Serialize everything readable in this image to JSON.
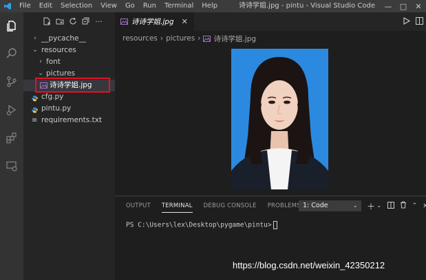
{
  "window": {
    "title": "诗诗学姐.jpg - pintu - Visual Studio Code",
    "menu": [
      "File",
      "Edit",
      "Selection",
      "View",
      "Go",
      "Run",
      "Terminal",
      "Help"
    ],
    "controls": [
      "—",
      "□",
      "✕"
    ]
  },
  "activity_bar": [
    "files-icon",
    "search-icon",
    "source-control-icon",
    "run-debug-icon",
    "extensions-icon",
    "remote-explorer-icon"
  ],
  "explorer": {
    "tree": [
      {
        "label": "__pycache__",
        "type": "folder",
        "expanded": false
      },
      {
        "label": "resources",
        "type": "folder",
        "expanded": true
      },
      {
        "label": "font",
        "type": "folder",
        "expanded": false
      },
      {
        "label": "pictures",
        "type": "folder",
        "expanded": true
      },
      {
        "label": "诗诗学姐.jpg",
        "type": "image",
        "selected": true
      },
      {
        "label": "cfg.py",
        "type": "python"
      },
      {
        "label": "pintu.py",
        "type": "python"
      },
      {
        "label": "requirements.txt",
        "type": "text"
      }
    ]
  },
  "editor": {
    "tab_label": "诗诗学姐.jpg",
    "breadcrumb": [
      "resources",
      "pictures",
      "诗诗学姐.jpg"
    ]
  },
  "panel": {
    "tabs": [
      "OUTPUT",
      "TERMINAL",
      "DEBUG CONSOLE",
      "PROBLEMS"
    ],
    "active_tab": "TERMINAL",
    "terminal_select": "1: Code",
    "prompt": "PS C:\\Users\\lex\\Desktop\\pygame\\pintu>"
  },
  "watermark": "https://blog.csdn.net/weixin_42350212",
  "colors": {
    "accent": "#007acc",
    "selection_box": "#e81123",
    "photo_background": "#2b8ae0"
  }
}
